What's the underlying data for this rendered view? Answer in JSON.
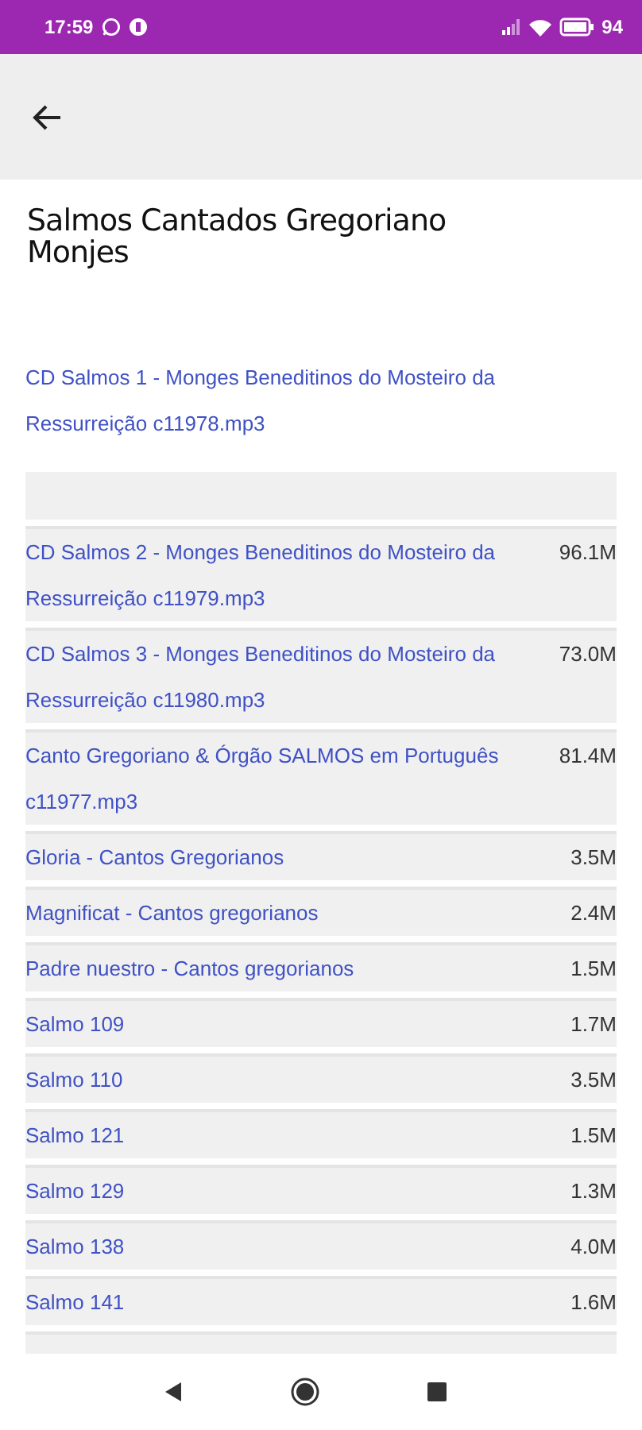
{
  "status_bar": {
    "time": "17:59",
    "battery": "94"
  },
  "title": "Salmos Cantados Gregoriano Monjes",
  "featured_link": " CD Salmos 1 - Monges Beneditinos do Mosteiro da Ressurreição c11978.mp3",
  "files": [
    {
      "kind": "empty"
    },
    {
      "kind": "file",
      "name": "CD Salmos 2 - Monges Beneditinos do Mosteiro da Ressurreição c11979.mp3",
      "size": "96.1M"
    },
    {
      "kind": "file",
      "name": "CD Salmos 3 - Monges Beneditinos do Mosteiro da Ressurreição c11980.mp3",
      "size": "73.0M"
    },
    {
      "kind": "file",
      "name": "Canto Gregoriano & Órgão SALMOS em Português c11977.mp3",
      "size": "81.4M"
    },
    {
      "kind": "file",
      "name": "Gloria - Cantos Gregorianos",
      "size": "3.5M"
    },
    {
      "kind": "file",
      "name": "Magnificat - Cantos gregorianos",
      "size": "2.4M"
    },
    {
      "kind": "file",
      "name": "Padre nuestro - Cantos gregorianos",
      "size": "1.5M"
    },
    {
      "kind": "file",
      "name": "Salmo 109",
      "size": "1.7M"
    },
    {
      "kind": "file",
      "name": "Salmo 110",
      "size": "3.5M"
    },
    {
      "kind": "file",
      "name": "Salmo 121",
      "size": "1.5M"
    },
    {
      "kind": "file",
      "name": "Salmo 129",
      "size": "1.3M"
    },
    {
      "kind": "file",
      "name": "Salmo 138",
      "size": "4.0M"
    },
    {
      "kind": "file",
      "name": "Salmo 141",
      "size": "1.6M"
    },
    {
      "kind": "empty"
    }
  ]
}
